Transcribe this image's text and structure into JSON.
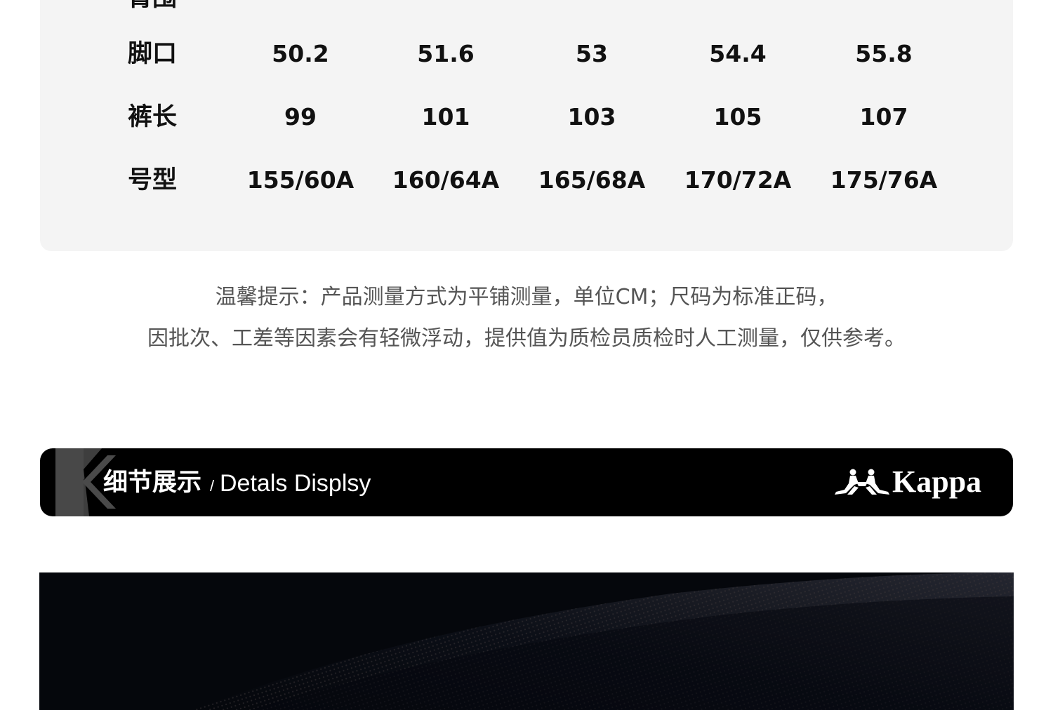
{
  "size_table": {
    "partial_top_row": {
      "label": "臀围",
      "values": [
        "",
        "",
        "",
        "",
        ""
      ]
    },
    "rows": [
      {
        "label": "脚口",
        "values": [
          "50.2",
          "51.6",
          "53",
          "54.4",
          "55.8"
        ]
      },
      {
        "label": "裤长",
        "values": [
          "99",
          "101",
          "103",
          "105",
          "107"
        ]
      },
      {
        "label": "号型",
        "values": [
          "155/60A",
          "160/64A",
          "165/68A",
          "170/72A",
          "175/76A"
        ]
      }
    ]
  },
  "notice": {
    "line1": "温馨提示：产品测量方式为平铺测量，单位CM；尺码为标准正码，",
    "line2": "因批次、工差等因素会有轻微浮动，提供值为质检员质检时人工测量，仅供参考。"
  },
  "section_banner": {
    "title_cn": "细节展示",
    "separator": "/",
    "title_en": "Detals Displsy",
    "logo_text": "Kappa",
    "logo_icon": "kappa-logo-icon"
  },
  "colors": {
    "panel_bg": "#f4f4f4",
    "banner_bg": "#000000",
    "text_dark": "#111111",
    "text_muted": "#555555"
  }
}
